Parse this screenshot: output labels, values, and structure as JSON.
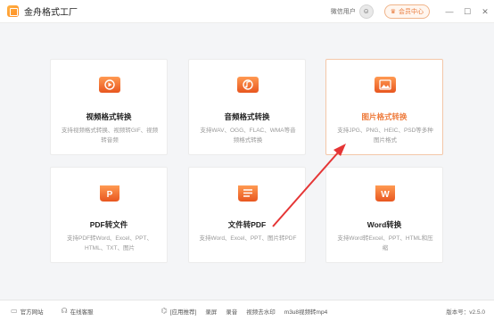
{
  "app": {
    "title": "金舟格式工厂",
    "user_name": "微信用户",
    "avatar_glyph": "☺",
    "member_label": "会员中心",
    "window_controls": [
      "—",
      "☐",
      "✕"
    ]
  },
  "cards": [
    {
      "title": "视频格式转换",
      "desc": "支持视频格式转换、视频转GIF、视频转音频",
      "icon": "video-icon",
      "active": false
    },
    {
      "title": "音频格式转换",
      "desc": "支持WAV、OGG、FLAC、WMA等音频格式转换",
      "icon": "audio-icon",
      "active": false
    },
    {
      "title": "图片格式转换",
      "desc": "支持JPG、PNG、HEIC、PSD等多种图片格式",
      "icon": "image-icon",
      "active": true
    },
    {
      "title": "PDF转文件",
      "desc": "支持PDF转Word、Excel、PPT、HTML、TXT、图片",
      "icon": "pdf-icon",
      "active": false
    },
    {
      "title": "文件转PDF",
      "desc": "支持Word、Excel、PPT、图片转PDF",
      "icon": "file-to-pdf-icon",
      "active": false
    },
    {
      "title": "Word转换",
      "desc": "支持Word转Excel、PPT、HTML和压缩",
      "icon": "word-icon",
      "active": false
    }
  ],
  "footer": {
    "website": "官方网站",
    "support": "在线客服",
    "recommend": "[应用推荐]",
    "links": [
      "录屏",
      "录音",
      "视频去水印",
      "m3u8视频转mp4"
    ],
    "version_label": "版本号：",
    "version": "v2.5.0"
  },
  "colors": {
    "accent": "#ee7b3c",
    "icon_gradient_top": "#ff9a52",
    "icon_gradient_bottom": "#e8561f",
    "annotation_arrow": "#e53535"
  }
}
